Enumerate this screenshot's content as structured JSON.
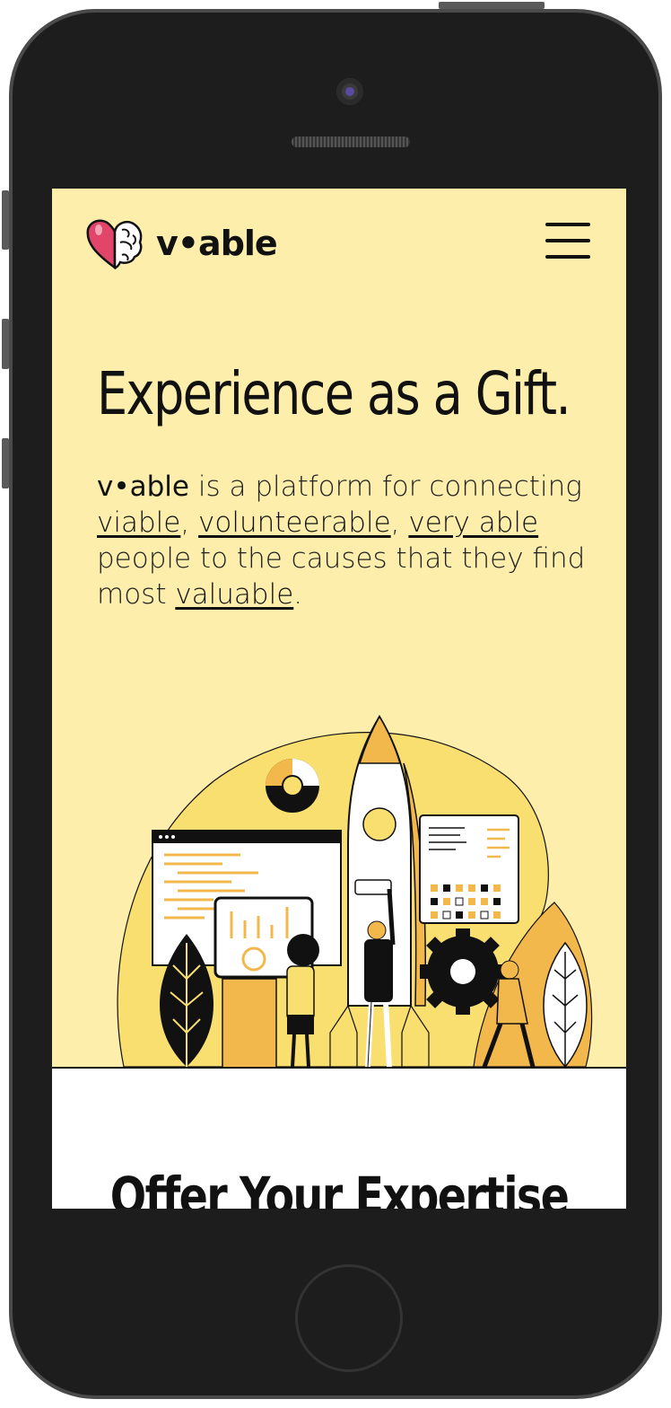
{
  "brand": {
    "name": "v•able",
    "icon": "heart-brain-icon",
    "colors": {
      "background": "#fdeeac",
      "accent": "#f2b84b",
      "heart": "#e2456a",
      "ink": "#111111"
    }
  },
  "nav": {
    "menu_icon": "hamburger-menu-icon"
  },
  "hero": {
    "title": "Experience as a Gift.",
    "text_brand": "v•able",
    "text_1": " is a platform for connecting ",
    "link_viable": "viable",
    "text_2": ", ",
    "link_volunteerable": "volunteerable",
    "text_3": ", ",
    "link_very_able": "very able",
    "text_4": " people to the causes that they find most ",
    "link_valuable": "valuable",
    "text_5": "."
  },
  "illustration": {
    "icon": "team-rocket-illustration"
  },
  "section": {
    "title": "Offer Your Expertise"
  }
}
